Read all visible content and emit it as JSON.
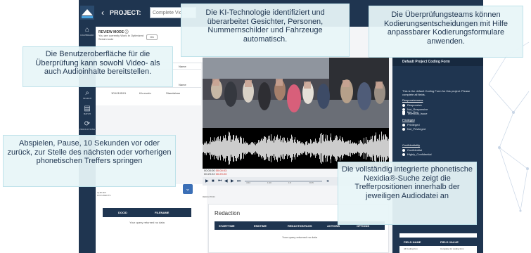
{
  "app": {
    "project_label": "PROJECT:",
    "project_input_placeholder": "Complete Vid...",
    "review": {
      "title": "REVIEW MODE ⓘ",
      "description": "You are currently Work In Optimized Serial mode",
      "toggle_label": "On"
    },
    "rail_items": [
      {
        "label": "DASHBOARD",
        "icon": "home-icon",
        "glyph": "⌂"
      },
      {
        "label": "SEARCH",
        "icon": "search-icon",
        "glyph": "⌕"
      },
      {
        "label": "BATCH",
        "icon": "batch-icon",
        "glyph": "▤"
      },
      {
        "label": "PRODUCTIONS",
        "icon": "refresh-icon",
        "glyph": "⟳"
      }
    ],
    "file_list": {
      "header_right": "Name",
      "row_right": "Name",
      "big_row": {
        "id": "1D1010D01",
        "file": "Kh.mvelo",
        "status": "Standalone"
      }
    },
    "doc_table": {
      "tab_label": "QUEUED DOCUMENTS",
      "col_docid": "DOCID",
      "col_filename": "FILENAME",
      "empty": "Your query returned no data"
    },
    "player": {
      "time_current": "00:00:00",
      "time_marker": "00:00:03",
      "time_total": "00:29:22",
      "time_end": "00:29:23",
      "ticks": [
        "4:04",
        "1:20",
        "1:6",
        "8:25"
      ]
    },
    "redaction": {
      "tab_label": "REDACTION",
      "title": "Redaction",
      "columns": [
        "STARTTIME",
        "ENDTIME",
        "REDACTIONTAGS",
        "ACTIONS",
        "OPTIONS"
      ],
      "empty": "Your query returned no data"
    },
    "coding": {
      "header": "Default Project Coding Form",
      "intro": "This is the default Coding Form for this project. Please complete all fields.",
      "responsiveness_label": "Responsiveness",
      "responsiveness_options": [
        "Responsive",
        "Not_Responsive",
        "Technical_Issue"
      ],
      "checkbox_label": "Not_Doc",
      "privileged_label": "Privileged",
      "privileged_options": [
        "Privileged",
        "Not_Privileged"
      ],
      "confidentiality_label": "Confidentiality",
      "confidentiality_options": [
        "Confidential",
        "Highly_Confidential"
      ],
      "field_table": {
        "col1": "FIELD NAME",
        "col2": "FIELD VALUE",
        "row_name": "All Coding Fun",
        "row_value": "Complete for coding form"
      }
    }
  },
  "callouts": {
    "top_center": "Die KI-Technologie identifiziert und überarbeitet Gesichter, Personen, Nummernschilder und Fahrzeuge automatisch.",
    "top_right": "Die Überprüfungsteams können Kodierungsentscheidungen mit Hilfe anpassbarer Kodierungsformulare anwenden.",
    "left_middle": "Die Benutzeroberfläche für die Überprüfung kann sowohl Video- als auch Audioinhalte bereitstellen.",
    "left_lower": "Abspielen, Pause, 10 Sekunden vor oder zurück, zur Stelle des nächsten oder vorherigen phonetischen Treffers springen",
    "bottom_right": "Die vollständig integrierte phonetische Nexidia®-Suche zeigt die Trefferpositionen innerhalb der jeweiligen Audiodatei an"
  },
  "colors": {
    "navy": "#1f3550",
    "callout_bg": "#e8f5f8",
    "accent_blue": "#3b6fb6",
    "time_red": "#d0261e"
  }
}
